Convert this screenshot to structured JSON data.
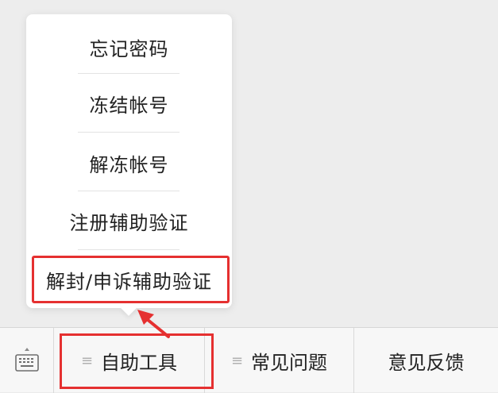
{
  "popup_menu": {
    "items": [
      {
        "label": "忘记密码"
      },
      {
        "label": "冻结帐号"
      },
      {
        "label": "解冻帐号"
      },
      {
        "label": "注册辅助验证"
      },
      {
        "label": "解封/申诉辅助验证"
      }
    ]
  },
  "bottom_bar": {
    "keyboard_icon": "keyboard-icon",
    "tabs": [
      {
        "label": "自助工具",
        "icon": "menu-lines-icon"
      },
      {
        "label": "常见问题",
        "icon": "menu-lines-icon"
      },
      {
        "label": "意见反馈"
      }
    ],
    "menu_glyph": "≡"
  },
  "annotation_color": "#e53030"
}
